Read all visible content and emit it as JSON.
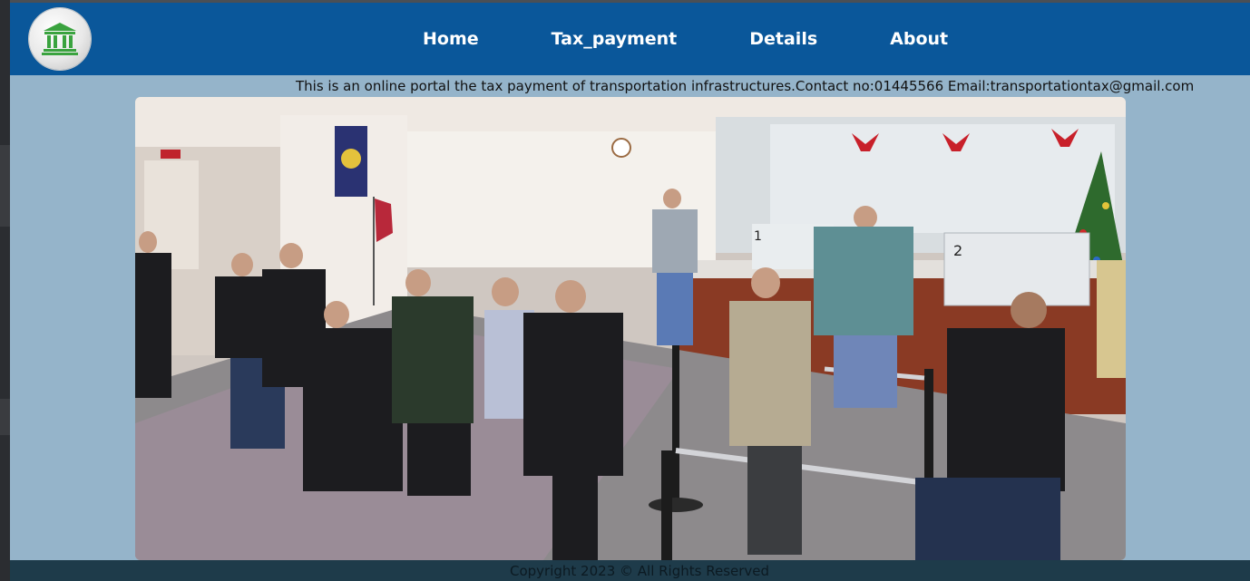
{
  "nav": {
    "logo_icon": "government-building-icon",
    "links": [
      {
        "label": "Home"
      },
      {
        "label": "Tax_payment"
      },
      {
        "label": "Details"
      },
      {
        "label": "About"
      }
    ]
  },
  "info": {
    "text": "This is an online portal the tax payment of transportation infrastructures.Contact no:01445566 Email:transportationtax@gmail.com"
  },
  "hero": {
    "counter_numbers": [
      "1",
      "2"
    ]
  },
  "footer": {
    "text": "Copyright 2023 © All Rights Reserved"
  },
  "colors": {
    "navbar": "#0a579a",
    "page_background": "#95b4ca",
    "footer": "#1e3b4a",
    "nav_text": "#ffffff"
  }
}
